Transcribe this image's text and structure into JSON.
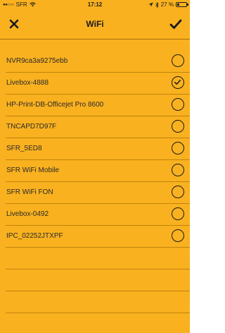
{
  "status_bar": {
    "carrier": "SFR",
    "time": "17:12",
    "battery": "27 %",
    "battery_level": 0.27
  },
  "nav": {
    "title": "WiFi"
  },
  "networks": [
    {
      "ssid": "NVR9ca3a9275ebb",
      "selected": false
    },
    {
      "ssid": "Livebox-4888",
      "selected": true
    },
    {
      "ssid": "HP-Print-DB-Officejet Pro 8600",
      "selected": false
    },
    {
      "ssid": "TNCAPD7D97F",
      "selected": false
    },
    {
      "ssid": "SFR_5ED8",
      "selected": false
    },
    {
      "ssid": "SFR WiFi Mobile",
      "selected": false
    },
    {
      "ssid": "SFR WiFi FON",
      "selected": false
    },
    {
      "ssid": "Livebox-0492",
      "selected": false
    },
    {
      "ssid": "IPC_02252JTXPF",
      "selected": false
    }
  ],
  "colors": {
    "background": "#f9b11f",
    "separator": "#c2830d",
    "icon": "#1a1a1a"
  },
  "icons": {
    "close": "close-icon",
    "confirm": "checkmark-icon",
    "radio_selected": "radio-checked-icon",
    "radio_unselected": "radio-unchecked-icon",
    "wifi": "wifi-icon",
    "location": "location-arrow-icon",
    "bluetooth": "bluetooth-icon",
    "battery": "battery-icon"
  }
}
